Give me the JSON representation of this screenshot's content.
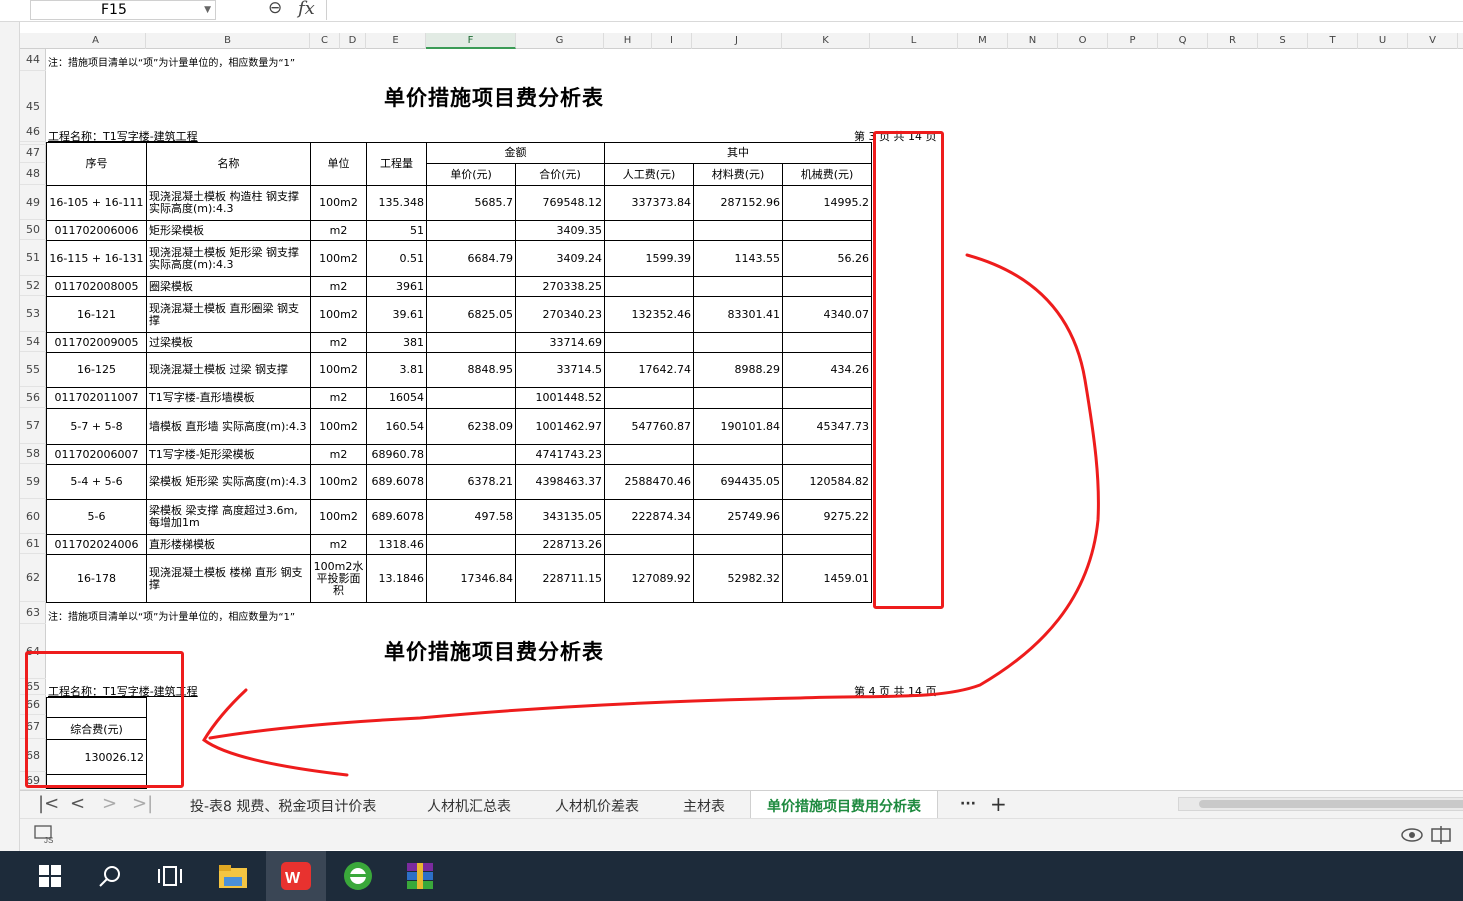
{
  "formula_bar": {
    "cell_ref": "F15",
    "fx": "fx"
  },
  "columns": [
    "A",
    "B",
    "C",
    "D",
    "E",
    "F",
    "G",
    "H",
    "I",
    "J",
    "K",
    "L",
    "M",
    "N",
    "O",
    "P",
    "Q",
    "R",
    "S",
    "T",
    "U",
    "V"
  ],
  "rows": [
    "44",
    "45",
    "46",
    "47",
    "48",
    "49",
    "50",
    "51",
    "52",
    "53",
    "54",
    "55",
    "56",
    "57",
    "58",
    "59",
    "60",
    "61",
    "62",
    "63",
    "64",
    "65",
    "66",
    "67",
    "68",
    "69"
  ],
  "sheet": {
    "note": "注：措施项目清单以“项”为计量单位的，相应数量为“1”",
    "title": "单价措施项目费分析表",
    "project": "工程名称：T1写字楼-建筑工程",
    "page_top": "第 3 页  共 14 页",
    "page_bottom": "第 4 页  共 14 页",
    "headers": {
      "seq": "序号",
      "name": "名称",
      "unit": "单位",
      "qty": "工程量",
      "amount": "金额",
      "of_which": "其中",
      "unit_price": "单价(元)",
      "total": "合价(元)",
      "labor": "人工费(元)",
      "material": "材料费(元)",
      "machine": "机械费(元)"
    },
    "rows": [
      {
        "code": "16-105 + 16-111",
        "name": "现浇混凝土模板 构造柱 钢支撑  实际高度(m):4.3",
        "unit": "100m2",
        "qty": "135.348",
        "price": "5685.7",
        "total": "769548.12",
        "labor": "337373.84",
        "material": "287152.96",
        "machine": "14995.2"
      },
      {
        "code": "011702006006",
        "name": "矩形梁模板",
        "unit": "m2",
        "qty": "51",
        "price": "",
        "total": "3409.35",
        "labor": "",
        "material": "",
        "machine": ""
      },
      {
        "code": "16-115 + 16-131",
        "name": "现浇混凝土模板 矩形梁 钢支撑  实际高度(m):4.3",
        "unit": "100m2",
        "qty": "0.51",
        "price": "6684.79",
        "total": "3409.24",
        "labor": "1599.39",
        "material": "1143.55",
        "machine": "56.26"
      },
      {
        "code": "011702008005",
        "name": "圈梁模板",
        "unit": "m2",
        "qty": "3961",
        "price": "",
        "total": "270338.25",
        "labor": "",
        "material": "",
        "machine": ""
      },
      {
        "code": "16-121",
        "name": "现浇混凝土模板 直形圈梁 钢支撑",
        "unit": "100m2",
        "qty": "39.61",
        "price": "6825.05",
        "total": "270340.23",
        "labor": "132352.46",
        "material": "83301.41",
        "machine": "4340.07"
      },
      {
        "code": "011702009005",
        "name": "过梁模板",
        "unit": "m2",
        "qty": "381",
        "price": "",
        "total": "33714.69",
        "labor": "",
        "material": "",
        "machine": ""
      },
      {
        "code": "16-125",
        "name": "现浇混凝土模板 过梁 钢支撑",
        "unit": "100m2",
        "qty": "3.81",
        "price": "8848.95",
        "total": "33714.5",
        "labor": "17642.74",
        "material": "8988.29",
        "machine": "434.26"
      },
      {
        "code": "011702011007",
        "name": "T1写字楼-直形墙模板",
        "unit": "m2",
        "qty": "16054",
        "price": "",
        "total": "1001448.52",
        "labor": "",
        "material": "",
        "machine": ""
      },
      {
        "code": "5-7 + 5-8",
        "name": "墙模板 直形墙  实际高度(m):4.3",
        "unit": "100m2",
        "qty": "160.54",
        "price": "6238.09",
        "total": "1001462.97",
        "labor": "547760.87",
        "material": "190101.84",
        "machine": "45347.73"
      },
      {
        "code": "011702006007",
        "name": "T1写字楼-矩形梁模板",
        "unit": "m2",
        "qty": "68960.78",
        "price": "",
        "total": "4741743.23",
        "labor": "",
        "material": "",
        "machine": ""
      },
      {
        "code": "5-4 + 5-6",
        "name": "梁模板 矩形梁  实际高度(m):4.3",
        "unit": "100m2",
        "qty": "689.6078",
        "price": "6378.21",
        "total": "4398463.37",
        "labor": "2588470.46",
        "material": "694435.05",
        "machine": "120584.82"
      },
      {
        "code": "5-6",
        "name": "梁模板 梁支撑 高度超过3.6m,每增加1m",
        "unit": "100m2",
        "qty": "689.6078",
        "price": "497.58",
        "total": "343135.05",
        "labor": "222874.34",
        "material": "25749.96",
        "machine": "9275.22"
      },
      {
        "code": "011702024006",
        "name": "直形楼梯模板",
        "unit": "m2",
        "qty": "1318.46",
        "price": "",
        "total": "228713.26",
        "labor": "",
        "material": "",
        "machine": ""
      },
      {
        "code": "16-178",
        "name": "现浇混凝土模板 楼梯 直形 钢支撑",
        "unit": "100m2水平投影面积",
        "qty": "13.1846",
        "price": "17346.84",
        "total": "228711.15",
        "labor": "127089.92",
        "material": "52982.32",
        "machine": "1459.01"
      }
    ],
    "small_table": {
      "header": "综合费(元)",
      "value": "130026.12"
    }
  },
  "tabs": {
    "items": [
      "投-表8 规费、税金项目计价表",
      "人材机汇总表",
      "人材机价差表",
      "主材表",
      "单价措施项目费用分析表"
    ],
    "active_index": 4,
    "more": "···",
    "add": "+"
  },
  "annotation_color": "#ee1c1c",
  "accent_color": "#1e8a3f"
}
